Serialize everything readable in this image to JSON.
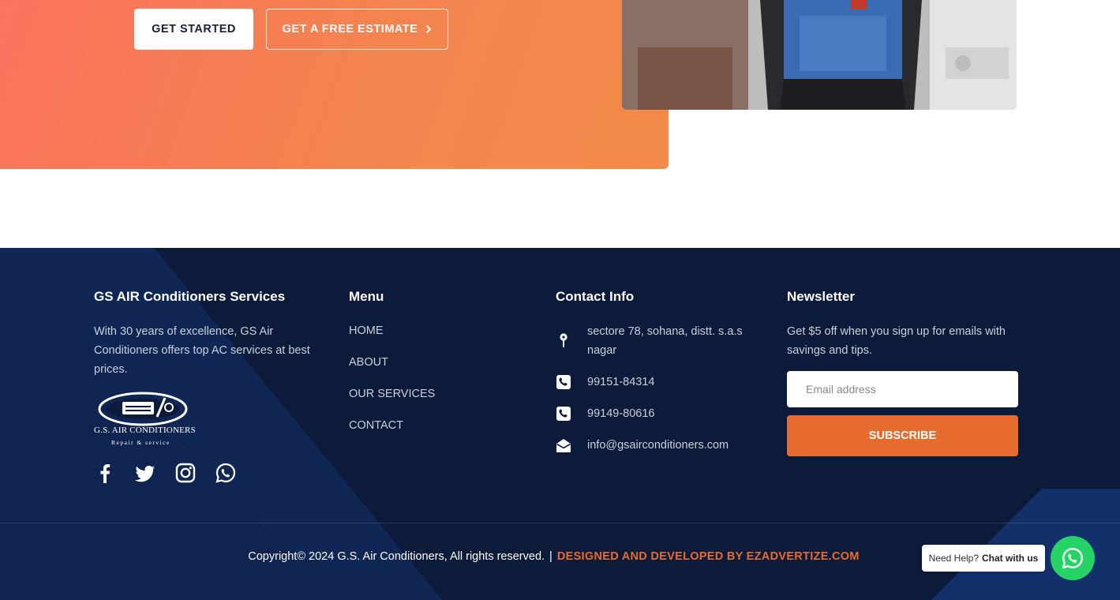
{
  "hero": {
    "get_started_label": "GET STARTED",
    "free_estimate_label": "GET A FREE ESTIMATE"
  },
  "footer": {
    "about": {
      "title": "GS AIR Conditioners Services",
      "text": "With 30 years of excellence, GS Air Conditioners offers top AC services at best prices.",
      "logo_name": "G.S. AIR CONDITIONERS",
      "logo_tagline": "Repair & service"
    },
    "menu": {
      "title": "Menu",
      "items": [
        "HOME",
        "ABOUT",
        "OUR SERVICES",
        "CONTACT"
      ]
    },
    "contact": {
      "title": "Contact Info",
      "address": "sectore 78, sohana, distt. s.a.s nagar",
      "phone1": "99151-84314",
      "phone2": "99149-80616",
      "email": "info@gsairconditioners.com"
    },
    "newsletter": {
      "title": "Newsletter",
      "text": "Get $5 off when you sign up for emails with savings and tips.",
      "email_placeholder": "Email address",
      "subscribe_label": "SUBSCRIBE"
    },
    "social_icons": [
      "facebook-icon",
      "twitter-icon",
      "instagram-icon",
      "whatsapp-icon"
    ],
    "copyright": "Copyright© 2024 G.S. Air Conditioners, All rights reserved.",
    "separator": "|",
    "developer": "DESIGNED AND DEVELOPED BY EZADVERTIZE.COM"
  },
  "chat_widget": {
    "need_help": "Need Help?",
    "chat_label": "Chat with us"
  },
  "colors": {
    "accent": "#e56c2e",
    "footer_bg": "#0d1b3a",
    "hero_gradient_start": "#fa735e",
    "hero_gradient_end": "#f38a4a",
    "whatsapp_green": "#25d366"
  }
}
